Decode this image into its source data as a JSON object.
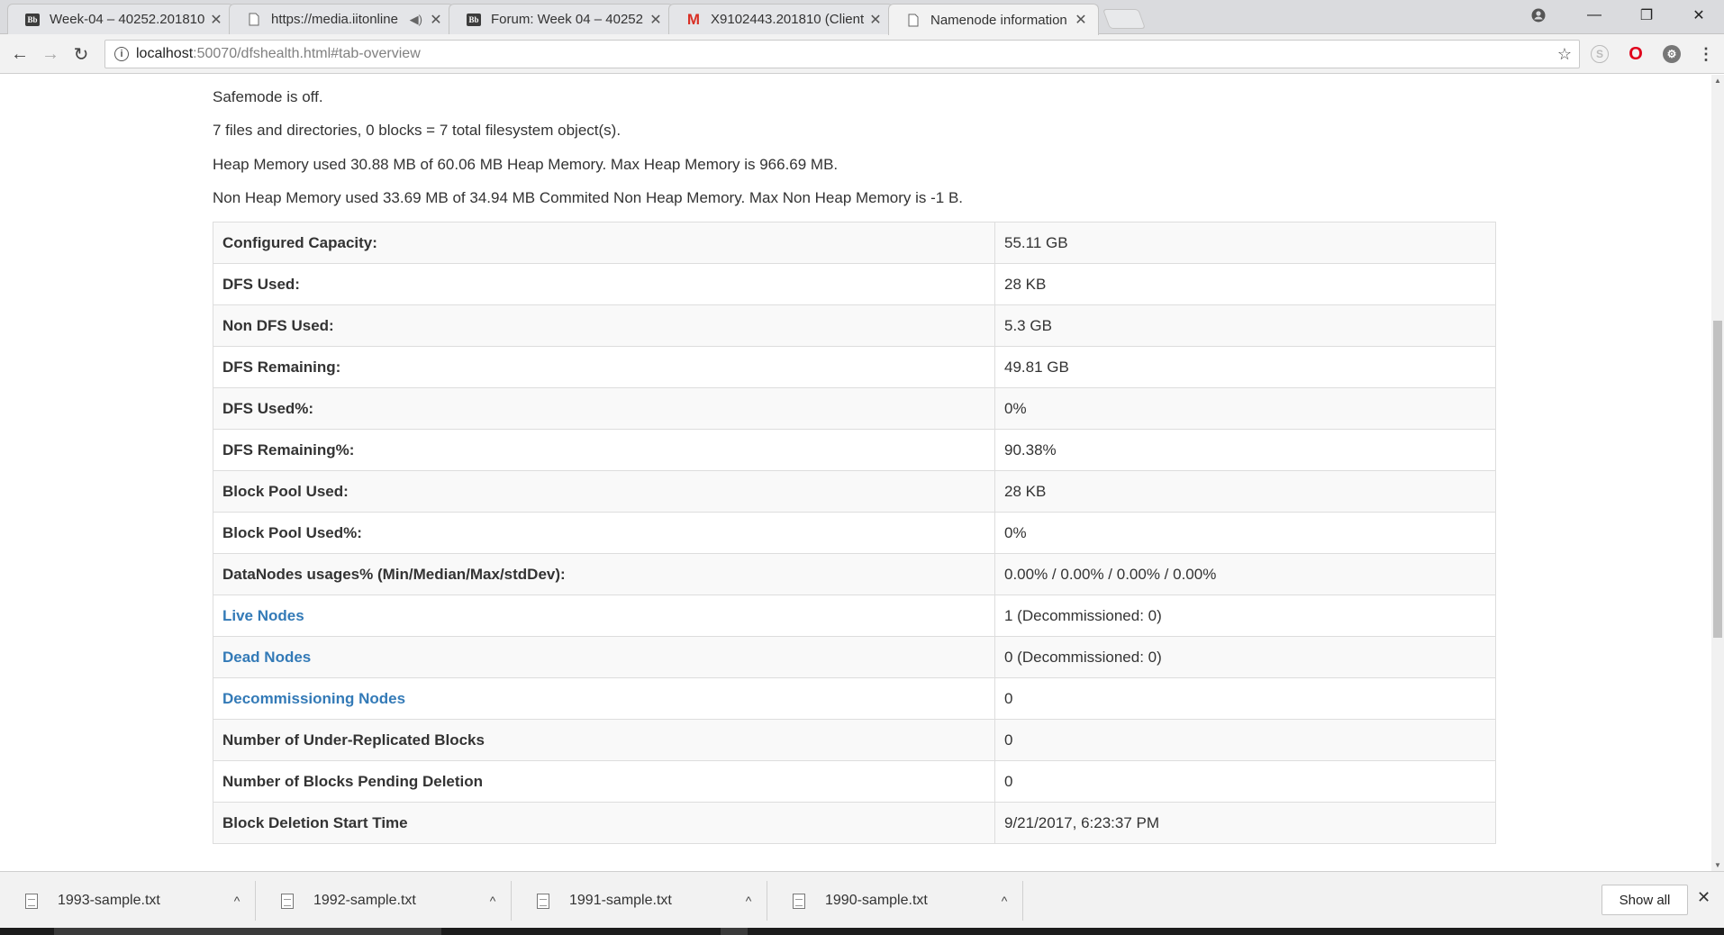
{
  "tabs": [
    {
      "title": "Week-04 – 40252.201810",
      "icon": "blackboard-icon",
      "active": false
    },
    {
      "title": "https://media.iitonline",
      "icon": "page-icon",
      "active": false,
      "audio": true
    },
    {
      "title": "Forum: Week 04 – 40252",
      "icon": "blackboard-icon",
      "active": false
    },
    {
      "title": "X9102443.201810 (Client",
      "icon": "gmail-icon",
      "active": false
    },
    {
      "title": "Namenode information",
      "icon": "page-icon",
      "active": true
    }
  ],
  "address": {
    "host": "localhost",
    "rest": ":50070/dfshealth.html#tab-overview"
  },
  "summary": {
    "safemode": "Safemode is off.",
    "files": "7 files and directories, 0 blocks = 7 total filesystem object(s).",
    "heap": "Heap Memory used 30.88 MB of 60.06 MB Heap Memory. Max Heap Memory is 966.69 MB.",
    "nonheap": "Non Heap Memory used 33.69 MB of 34.94 MB Commited Non Heap Memory. Max Non Heap Memory is -1 B."
  },
  "table": [
    {
      "label": "Configured Capacity:",
      "value": "55.11 GB",
      "link": false
    },
    {
      "label": "DFS Used:",
      "value": "28 KB",
      "link": false
    },
    {
      "label": "Non DFS Used:",
      "value": "5.3 GB",
      "link": false
    },
    {
      "label": "DFS Remaining:",
      "value": "49.81 GB",
      "link": false
    },
    {
      "label": "DFS Used%:",
      "value": "0%",
      "link": false
    },
    {
      "label": "DFS Remaining%:",
      "value": "90.38%",
      "link": false
    },
    {
      "label": "Block Pool Used:",
      "value": "28 KB",
      "link": false
    },
    {
      "label": "Block Pool Used%:",
      "value": "0%",
      "link": false
    },
    {
      "label": "DataNodes usages% (Min/Median/Max/stdDev):",
      "value": "0.00% / 0.00% / 0.00% / 0.00%",
      "link": false
    },
    {
      "label": "Live Nodes",
      "value": "1 (Decommissioned: 0)",
      "link": true
    },
    {
      "label": "Dead Nodes",
      "value": "0 (Decommissioned: 0)",
      "link": true
    },
    {
      "label": "Decommissioning Nodes",
      "value": "0",
      "link": true
    },
    {
      "label": "Number of Under-Replicated Blocks",
      "value": "0",
      "link": false
    },
    {
      "label": "Number of Blocks Pending Deletion",
      "value": "0",
      "link": false
    },
    {
      "label": "Block Deletion Start Time",
      "value": "9/21/2017, 6:23:37 PM",
      "link": false
    }
  ],
  "downloads": [
    {
      "name": "1993-sample.txt"
    },
    {
      "name": "1992-sample.txt"
    },
    {
      "name": "1991-sample.txt"
    },
    {
      "name": "1990-sample.txt"
    }
  ],
  "shelf": {
    "show_all": "Show all"
  },
  "colors": {
    "link": "#337ab7",
    "stripe": "#f9f9f9",
    "border": "#dddddd"
  }
}
